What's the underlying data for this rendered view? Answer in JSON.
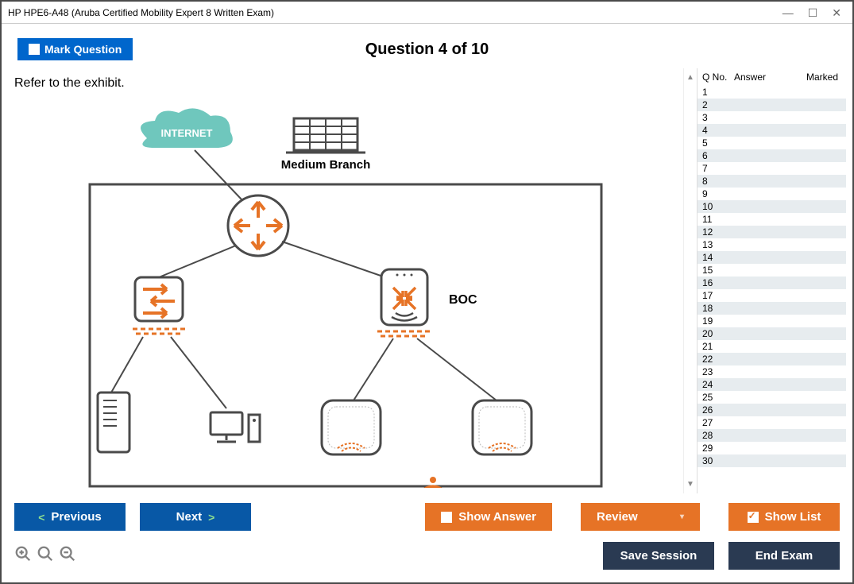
{
  "window": {
    "title": "HP HPE6-A48 (Aruba Certified Mobility Expert 8 Written Exam)"
  },
  "header": {
    "mark_label": "Mark Question",
    "question_title": "Question 4 of 10"
  },
  "question": {
    "prompt": "Refer to the exhibit.",
    "exhibit_labels": {
      "internet": "INTERNET",
      "branch": "Medium Branch",
      "boc": "BOC"
    }
  },
  "sidebar": {
    "headers": {
      "qno": "Q No.",
      "answer": "Answer",
      "marked": "Marked"
    },
    "rows": [
      {
        "qno": "1",
        "answer": "",
        "marked": ""
      },
      {
        "qno": "2",
        "answer": "",
        "marked": ""
      },
      {
        "qno": "3",
        "answer": "",
        "marked": ""
      },
      {
        "qno": "4",
        "answer": "",
        "marked": ""
      },
      {
        "qno": "5",
        "answer": "",
        "marked": ""
      },
      {
        "qno": "6",
        "answer": "",
        "marked": ""
      },
      {
        "qno": "7",
        "answer": "",
        "marked": ""
      },
      {
        "qno": "8",
        "answer": "",
        "marked": ""
      },
      {
        "qno": "9",
        "answer": "",
        "marked": ""
      },
      {
        "qno": "10",
        "answer": "",
        "marked": ""
      },
      {
        "qno": "11",
        "answer": "",
        "marked": ""
      },
      {
        "qno": "12",
        "answer": "",
        "marked": ""
      },
      {
        "qno": "13",
        "answer": "",
        "marked": ""
      },
      {
        "qno": "14",
        "answer": "",
        "marked": ""
      },
      {
        "qno": "15",
        "answer": "",
        "marked": ""
      },
      {
        "qno": "16",
        "answer": "",
        "marked": ""
      },
      {
        "qno": "17",
        "answer": "",
        "marked": ""
      },
      {
        "qno": "18",
        "answer": "",
        "marked": ""
      },
      {
        "qno": "19",
        "answer": "",
        "marked": ""
      },
      {
        "qno": "20",
        "answer": "",
        "marked": ""
      },
      {
        "qno": "21",
        "answer": "",
        "marked": ""
      },
      {
        "qno": "22",
        "answer": "",
        "marked": ""
      },
      {
        "qno": "23",
        "answer": "",
        "marked": ""
      },
      {
        "qno": "24",
        "answer": "",
        "marked": ""
      },
      {
        "qno": "25",
        "answer": "",
        "marked": ""
      },
      {
        "qno": "26",
        "answer": "",
        "marked": ""
      },
      {
        "qno": "27",
        "answer": "",
        "marked": ""
      },
      {
        "qno": "28",
        "answer": "",
        "marked": ""
      },
      {
        "qno": "29",
        "answer": "",
        "marked": ""
      },
      {
        "qno": "30",
        "answer": "",
        "marked": ""
      }
    ]
  },
  "footer": {
    "previous": "Previous",
    "next": "Next",
    "show_answer": "Show Answer",
    "review": "Review",
    "show_list": "Show List",
    "save_session": "Save Session",
    "end_exam": "End Exam"
  }
}
